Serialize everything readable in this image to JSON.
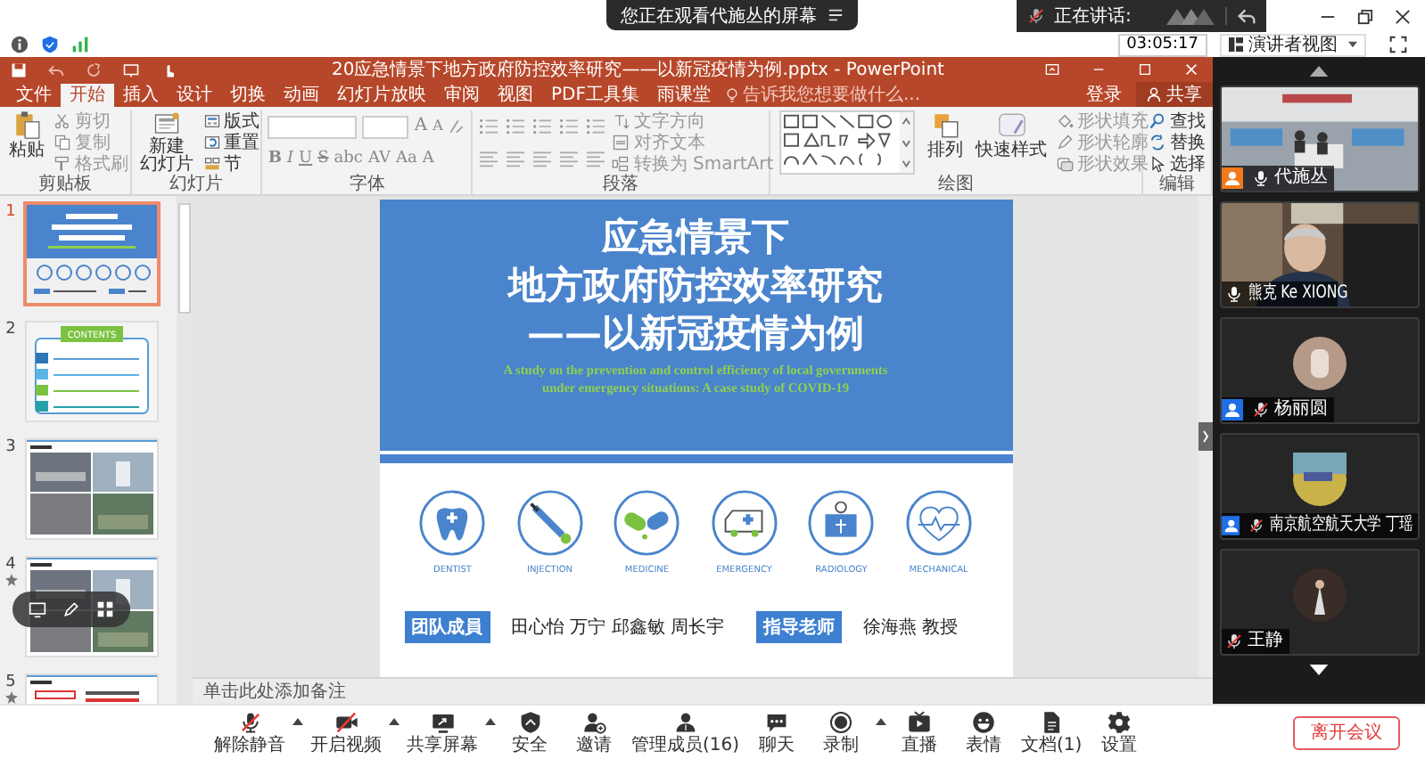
{
  "share_banner": {
    "text": "您正在观看代施丛的屏幕"
  },
  "speaking_panel": {
    "label": "正在讲话:"
  },
  "meeting_info": {
    "timer": "03:05:17",
    "view_button": "演讲者视图"
  },
  "powerpoint": {
    "title": "20应急情景下地方政府防控效率研究——以新冠疫情为例.pptx - PowerPoint",
    "tabs": [
      {
        "label": "文件",
        "selected": false
      },
      {
        "label": "开始",
        "selected": true
      },
      {
        "label": "插入",
        "selected": false
      },
      {
        "label": "设计",
        "selected": false
      },
      {
        "label": "切换",
        "selected": false
      },
      {
        "label": "动画",
        "selected": false
      },
      {
        "label": "幻灯片放映",
        "selected": false
      },
      {
        "label": "审阅",
        "selected": false
      },
      {
        "label": "视图",
        "selected": false
      },
      {
        "label": "PDF工具集",
        "selected": false
      },
      {
        "label": "雨课堂",
        "selected": false
      }
    ],
    "tell_me": {
      "placeholder": "告诉我您想要做什么..."
    },
    "sign_in": "登录",
    "share": "共享",
    "ribbon_groups": [
      {
        "label": "剪贴板",
        "items": [
          {
            "kind": "large",
            "lines": [
              "粘贴"
            ]
          },
          {
            "kind": "small",
            "label": "剪切",
            "disabled": true
          },
          {
            "kind": "small",
            "label": "复制",
            "disabled": true
          },
          {
            "kind": "small",
            "label": "格式刷",
            "disabled": true
          }
        ]
      },
      {
        "label": "幻灯片",
        "items": [
          {
            "kind": "large",
            "lines": [
              "新建",
              "幻灯片"
            ]
          },
          {
            "kind": "small",
            "label": "版式",
            "disabled": false
          },
          {
            "kind": "small",
            "label": "重置",
            "disabled": false
          },
          {
            "kind": "small",
            "label": "节",
            "disabled": false
          }
        ]
      },
      {
        "label": "字体",
        "items": [
          {
            "kind": "font",
            "size_buttons": [
              "A",
              "A"
            ],
            "format_buttons": [
              "B",
              "I",
              "U",
              "S",
              "abc",
              "AV",
              "Aa",
              "A"
            ]
          }
        ]
      },
      {
        "label": "段落",
        "items": [
          {
            "kind": "paragraph"
          },
          {
            "kind": "small",
            "label": "文字方向",
            "disabled": true
          },
          {
            "kind": "small",
            "label": "对齐文本",
            "disabled": true
          },
          {
            "kind": "small",
            "label": "转换为 SmartArt",
            "disabled": true
          }
        ]
      },
      {
        "label": "绘图",
        "items": [
          {
            "kind": "shapes"
          },
          {
            "kind": "large",
            "lines": [
              "排列"
            ]
          },
          {
            "kind": "large",
            "lines": [
              "快速样式"
            ]
          },
          {
            "kind": "small",
            "label": "形状填充",
            "disabled": true
          },
          {
            "kind": "small",
            "label": "形状轮廓",
            "disabled": true
          },
          {
            "kind": "small",
            "label": "形状效果",
            "disabled": true
          }
        ]
      },
      {
        "label": "编辑",
        "items": [
          {
            "kind": "small",
            "label": "查找",
            "disabled": false
          },
          {
            "kind": "small",
            "label": "替换",
            "disabled": false
          },
          {
            "kind": "small",
            "label": "选择",
            "disabled": false
          }
        ]
      }
    ],
    "thumbnails": [
      {
        "number": "1",
        "selected": true,
        "animated": false,
        "kind": "title"
      },
      {
        "number": "2",
        "selected": false,
        "animated": false,
        "kind": "contents",
        "heading": "CONTENTS"
      },
      {
        "number": "3",
        "selected": false,
        "animated": false,
        "kind": "photos"
      },
      {
        "number": "4",
        "selected": false,
        "animated": true,
        "kind": "photos"
      },
      {
        "number": "5",
        "selected": false,
        "animated": true,
        "kind": "text"
      }
    ],
    "slide": {
      "title_lines": [
        "应急情景下",
        "地方政府防控效率研究",
        "——以新冠疫情为例"
      ],
      "subtitle_lines": [
        "A study on the prevention and control efficiency of local governments",
        "under emergency situations: A case study of COVID-19"
      ],
      "icons": [
        {
          "kind": "tooth",
          "label": "DENTIST"
        },
        {
          "kind": "syringe",
          "label": "INJECTION"
        },
        {
          "kind": "pills",
          "label": "MEDICINE"
        },
        {
          "kind": "ambulance",
          "label": "EMERGENCY"
        },
        {
          "kind": "xray",
          "label": "RADIOLOGY"
        },
        {
          "kind": "heart",
          "label": "MECHANICAL"
        }
      ],
      "team_label": "团队成員",
      "team_names": "田心怡 万宁 邱鑫敏 周长宇",
      "advisor_label": "指导老师",
      "advisor_names": "徐海燕 教授"
    },
    "notes_placeholder": "单击此处添加备注"
  },
  "participants": [
    {
      "name": "代施丛",
      "kind": "video",
      "muted": false,
      "color": "#f07a1c"
    },
    {
      "name": "熊克 Ke XIONG",
      "kind": "video",
      "muted": false
    },
    {
      "name": "杨丽圆",
      "kind": "avatar",
      "muted": true,
      "color": "#1f6fe5"
    },
    {
      "name": "南京航空航天大学 丁瑶",
      "kind": "avatar",
      "muted": true,
      "color": "#1f6fe5"
    },
    {
      "name": "王静",
      "kind": "avatar",
      "muted": true
    }
  ],
  "toolbar": [
    {
      "kind": "mic-off",
      "label": "解除静音",
      "menu": true
    },
    {
      "kind": "video-off",
      "label": "开启视频",
      "menu": true
    },
    {
      "kind": "share-screen",
      "label": "共享屏幕",
      "menu": true
    },
    {
      "kind": "shield",
      "label": "安全",
      "menu": false
    },
    {
      "kind": "invite",
      "label": "邀请",
      "menu": false
    },
    {
      "kind": "members",
      "label": "管理成员(16)",
      "menu": false
    },
    {
      "kind": "chat",
      "label": "聊天",
      "menu": false
    },
    {
      "kind": "record",
      "label": "录制",
      "menu": true
    },
    {
      "kind": "live",
      "label": "直播",
      "menu": false
    },
    {
      "kind": "emoji",
      "label": "表情",
      "menu": false
    },
    {
      "kind": "document",
      "label": "文档(1)",
      "menu": false
    },
    {
      "kind": "gear",
      "label": "设置",
      "menu": false
    }
  ],
  "leave_button": "离开会议"
}
